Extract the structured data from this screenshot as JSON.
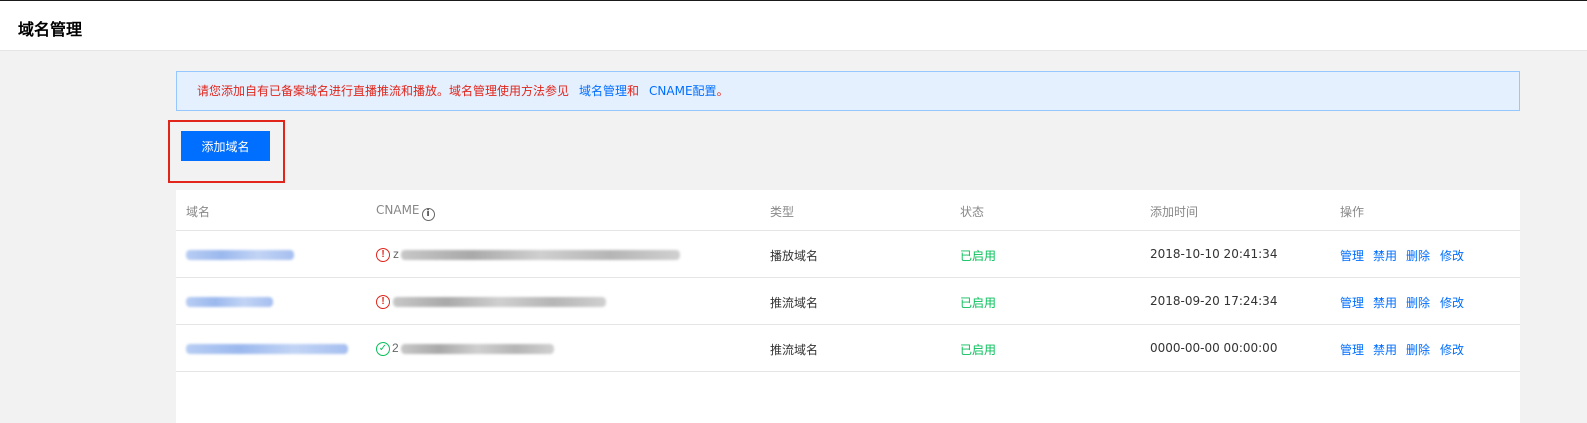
{
  "header": {
    "title": "域名管理"
  },
  "notice": {
    "text": "请您添加自有已备案域名进行直播推流和播放。域名管理使用方法参见",
    "link1": "域名管理",
    "joiner": "和",
    "link2": "CNAME配置",
    "end": "。"
  },
  "actions": {
    "add_domain": "添加域名"
  },
  "table": {
    "columns": {
      "domain": "域名",
      "cname": "CNAME",
      "type": "类型",
      "status": "状态",
      "added_time": "添加时间",
      "ops": "操作"
    },
    "rows": [
      {
        "cname_status": "error",
        "cname_prefix": "z",
        "type": "播放域名",
        "status": "已启用",
        "added_time": "2018-10-10 20:41:34",
        "ops": [
          "管理",
          "禁用",
          "删除",
          "修改"
        ]
      },
      {
        "cname_status": "error",
        "cname_prefix": "",
        "type": "推流域名",
        "status": "已启用",
        "added_time": "2018-09-20 17:24:34",
        "ops": [
          "管理",
          "禁用",
          "删除",
          "修改"
        ]
      },
      {
        "cname_status": "ok",
        "cname_prefix": "2",
        "type": "推流域名",
        "status": "已启用",
        "added_time": "0000-00-00 00:00:00",
        "ops": [
          "管理",
          "禁用",
          "删除",
          "修改"
        ]
      }
    ]
  },
  "colors": {
    "accent": "#006eff",
    "error": "#e1251b",
    "success": "#0abf5b",
    "notice_bg": "#e5f0ff"
  }
}
